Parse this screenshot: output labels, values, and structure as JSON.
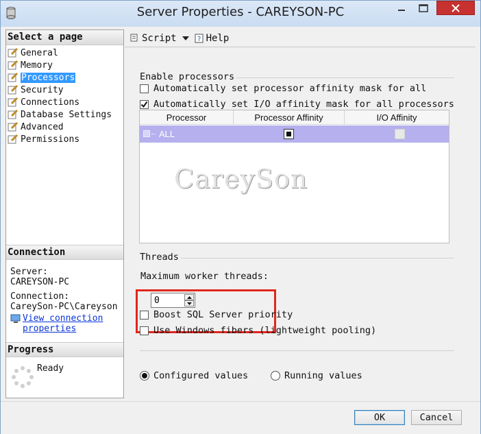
{
  "window": {
    "title": "Server Properties - CAREYSON-PC"
  },
  "left": {
    "select_page_header": "Select a page",
    "pages": [
      {
        "label": "General"
      },
      {
        "label": "Memory"
      },
      {
        "label": "Processors"
      },
      {
        "label": "Security"
      },
      {
        "label": "Connections"
      },
      {
        "label": "Database Settings"
      },
      {
        "label": "Advanced"
      },
      {
        "label": "Permissions"
      }
    ],
    "active_page": "Processors",
    "connection_header": "Connection",
    "server_label": "Server:",
    "server_value": "CAREYSON-PC",
    "connection_label": "Connection:",
    "connection_value": "CareySon-PC\\Careyson",
    "view_link_line1": "View connection",
    "view_link_line2": "properties",
    "progress_header": "Progress",
    "progress_status": "Ready"
  },
  "toolbar": {
    "script_label": "Script",
    "help_label": "Help"
  },
  "processors": {
    "enable_group": "Enable processors",
    "auto_affinity_label": "Automatically set processor affinity mask for all",
    "auto_affinity_checked": false,
    "auto_io_label": "Automatically set I/O affinity mask for all processors",
    "auto_io_checked": true,
    "grid": {
      "columns": [
        "Processor",
        "Processor Affinity",
        "I/O Affinity"
      ],
      "rows": [
        {
          "processor": "ALL"
        }
      ]
    },
    "watermark": "CareySon"
  },
  "threads": {
    "group": "Threads",
    "max_worker_label": "Maximum worker threads:",
    "max_worker_value": "0",
    "boost_label": "Boost SQL Server priority",
    "fibers_label": "Use Windows fibers (lightweight pooling)"
  },
  "view_mode": {
    "configured_label": "Configured values",
    "running_label": "Running values",
    "selected": "configured"
  },
  "buttons": {
    "ok": "OK",
    "cancel": "Cancel"
  },
  "colors": {
    "selection": "#3399ff",
    "grid_row": "#b6b0ee",
    "close_button": "#c7312f",
    "highlight_box": "#e1261c",
    "link": "#0a34d8"
  }
}
